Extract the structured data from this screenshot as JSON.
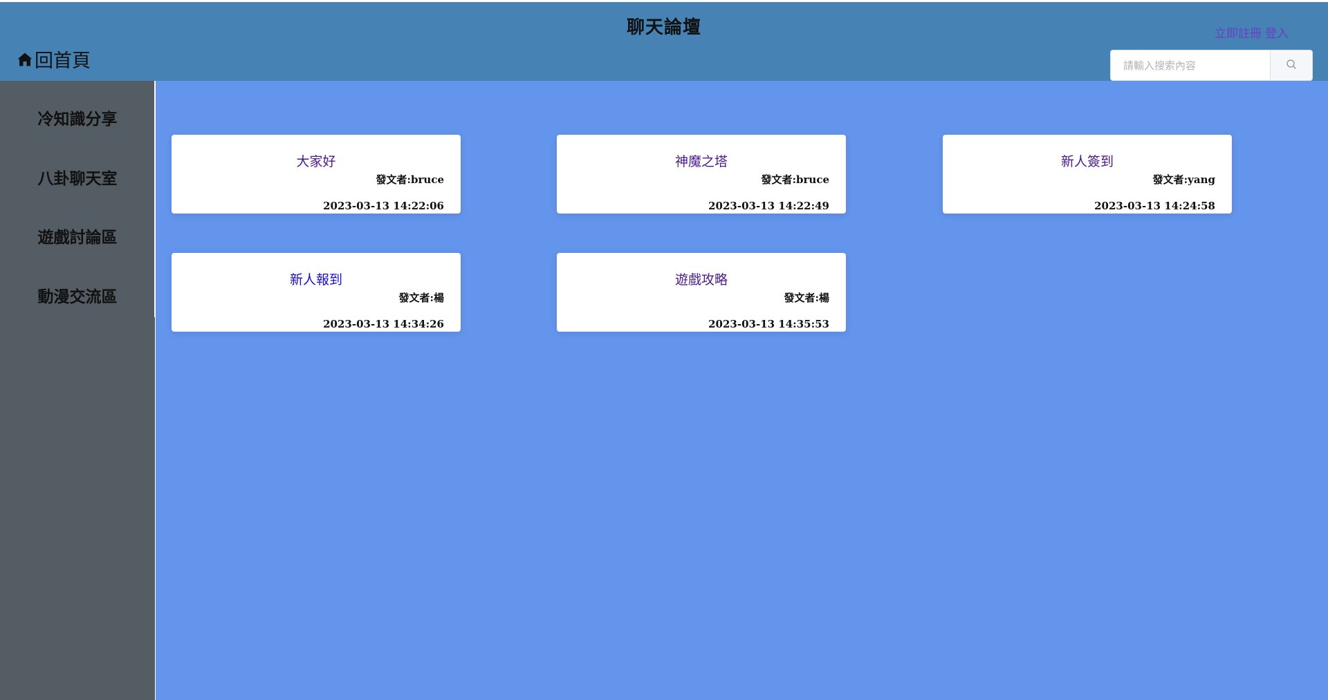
{
  "header": {
    "title": "聊天論壇",
    "home_label": "回首頁",
    "register_label": "立即註冊",
    "login_label": "登入",
    "home_icon": "home-icon",
    "search_icon": "search-icon",
    "accent_color": "#4682b4"
  },
  "search": {
    "placeholder": "請輸入搜索內容",
    "value": ""
  },
  "sidebar": {
    "items": [
      {
        "label": "冷知識分享"
      },
      {
        "label": "八卦聊天室"
      },
      {
        "label": "遊戲討論區"
      },
      {
        "label": "動漫交流區"
      }
    ],
    "background_color": "#545c64"
  },
  "main": {
    "background_color": "#6495ed",
    "posts": [
      {
        "title": "大家好",
        "author": "發文者:bruce",
        "datetime": "2023-03-13 14:22:06"
      },
      {
        "title": "神魔之塔",
        "author": "發文者:bruce",
        "datetime": "2023-03-13 14:22:49"
      },
      {
        "title": "新人簽到",
        "author": "發文者:yang",
        "datetime": "2023-03-13 14:24:58"
      },
      {
        "title": "新人報到",
        "author": "發文者:楊",
        "datetime": "2023-03-13 14:34:26"
      },
      {
        "title": "遊戲攻略",
        "author": "發文者:楊",
        "datetime": "2023-03-13 14:35:53"
      }
    ]
  }
}
